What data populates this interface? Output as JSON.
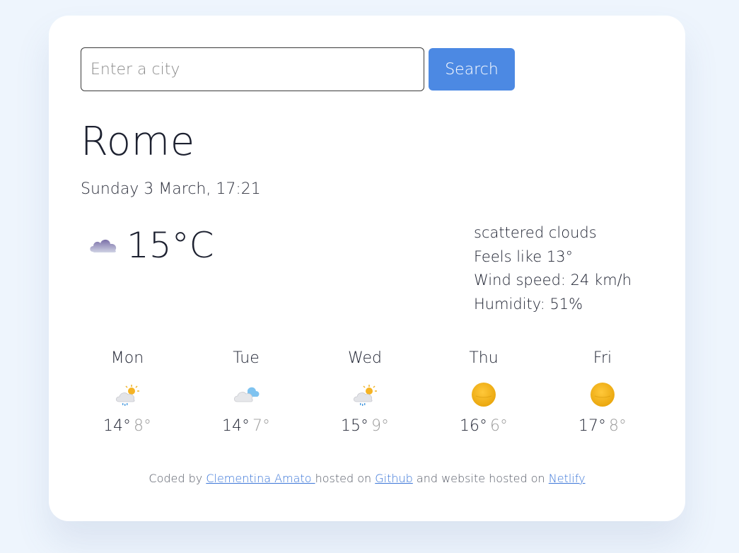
{
  "search": {
    "placeholder": "Enter a city",
    "button_label": "Search"
  },
  "current": {
    "city": "Rome",
    "date": "Sunday 3 March, 17:21",
    "icon": "cloud-icon",
    "temperature": "15°C",
    "description": "scattered clouds",
    "feels_like": "Feels like 13°",
    "wind": "Wind speed: 24 km/h",
    "humidity": "Humidity: 51%"
  },
  "forecast": [
    {
      "day": "Mon",
      "icon": "sun-cloud-rain-icon",
      "max": "14°",
      "min": "8°"
    },
    {
      "day": "Tue",
      "icon": "sun-cloud-icon",
      "max": "14°",
      "min": "7°"
    },
    {
      "day": "Wed",
      "icon": "sun-cloud-rain-icon",
      "max": "15°",
      "min": "9°"
    },
    {
      "day": "Thu",
      "icon": "sun-icon",
      "max": "16°",
      "min": "6°"
    },
    {
      "day": "Fri",
      "icon": "sun-icon",
      "max": "17°",
      "min": "8°"
    }
  ],
  "footer": {
    "prefix": "Coded by ",
    "author": "Clementina Amato ",
    "middle": "hosted on ",
    "github": "Github",
    "middle2": " and website hosted on ",
    "netlify": "Netlify"
  },
  "colors": {
    "accent": "#4c89e3",
    "background": "#eef5fd",
    "link": "#3b76d8"
  }
}
